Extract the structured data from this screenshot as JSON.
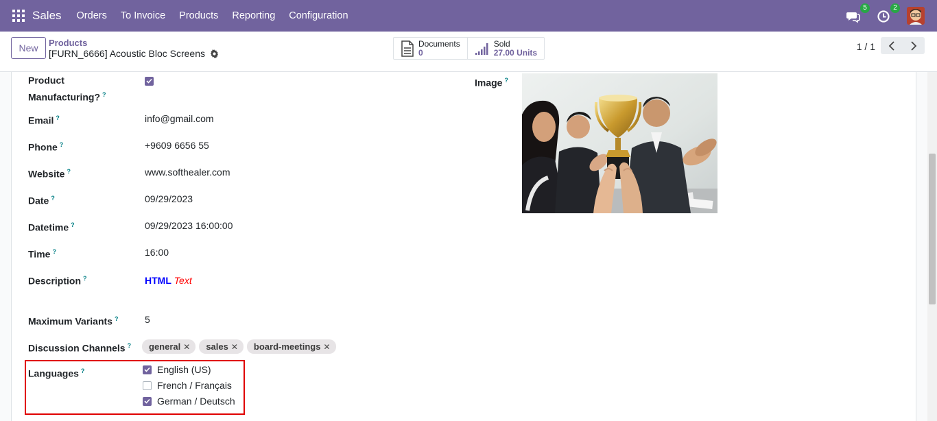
{
  "navbar": {
    "brand": "Sales",
    "menu": [
      "Orders",
      "To Invoice",
      "Products",
      "Reporting",
      "Configuration"
    ],
    "messages_badge": "5",
    "activities_badge": "2",
    "accent": "#71639e"
  },
  "control": {
    "new_label": "New",
    "breadcrumb_parent": "Products",
    "breadcrumb_current": "[FURN_6666] Acoustic Bloc Screens",
    "documents_label": "Documents",
    "documents_value": "0",
    "sold_label": "Sold",
    "sold_value": "27.00 Units",
    "pager": "1 / 1"
  },
  "form": {
    "product_manufacturing_label_1": "Product",
    "product_manufacturing_label_2": "Manufacturing?",
    "product_manufacturing_checked": true,
    "email_label": "Email",
    "email_value": "info@gmail.com",
    "phone_label": "Phone",
    "phone_value": "+9609 6656 55",
    "website_label": "Website",
    "website_value": "www.softhealer.com",
    "date_label": "Date",
    "date_value": "09/29/2023",
    "datetime_label": "Datetime",
    "datetime_value": "09/29/2023 16:00:00",
    "time_label": "Time",
    "time_value": "16:00",
    "description_label": "Description",
    "description_bold": "HTML",
    "description_italic": "Text",
    "max_variants_label": "Maximum Variants",
    "max_variants_value": "5",
    "channels_label": "Discussion Channels",
    "channels": [
      "general",
      "sales",
      "board-meetings"
    ],
    "languages_label": "Languages",
    "languages": [
      {
        "name": "English (US)",
        "checked": true
      },
      {
        "name": "French / Français",
        "checked": false
      },
      {
        "name": "German / Deutsch",
        "checked": true
      }
    ],
    "image_label": "Image",
    "help_mark": "?"
  }
}
